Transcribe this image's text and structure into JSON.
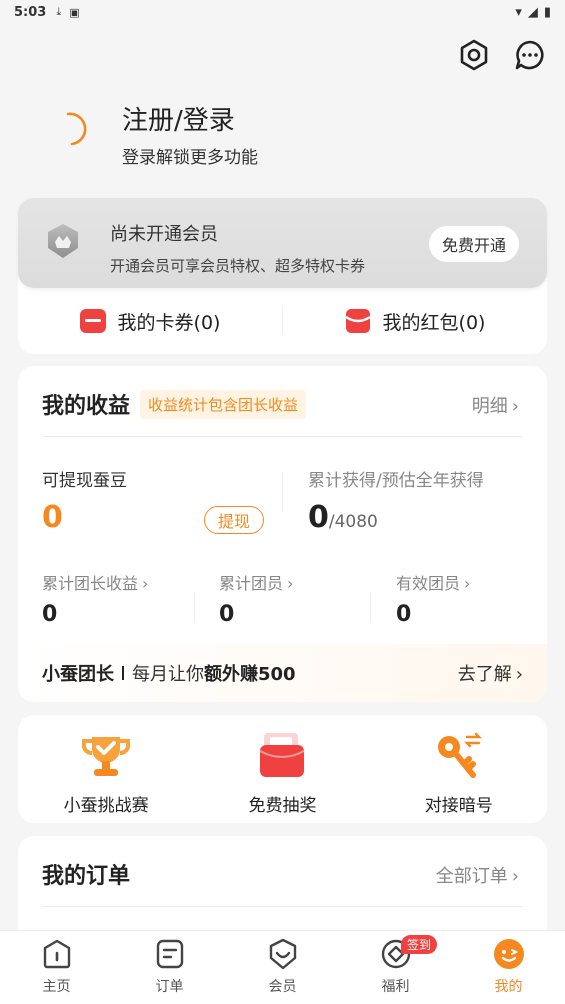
{
  "status_bar": {
    "time": "5:03"
  },
  "header": {
    "settings_icon": "settings-hex-icon",
    "message_icon": "chat-bubble-icon"
  },
  "profile": {
    "title": "注册/登录",
    "subtitle": "登录解锁更多功能"
  },
  "member": {
    "title": "尚未开通会员",
    "subtitle": "开通会员可享会员特权、超多特权卡券",
    "open_button": "免费开通"
  },
  "coupons": [
    {
      "label": "我的卡券(0)",
      "icon": "ticket-icon"
    },
    {
      "label": "我的红包(0)",
      "icon": "red-envelope-icon"
    }
  ],
  "earnings": {
    "title": "我的收益",
    "tag": "收益统计包含团长收益",
    "detail": "明细",
    "withdraw_label": "可提现蚕豆",
    "withdraw_value": "0",
    "withdraw_button": "提现",
    "total_label": "累计获得/预估全年获得",
    "total_value": "0",
    "total_estimate": "/4080",
    "stats": [
      {
        "label": "累计团长收益",
        "value": "0"
      },
      {
        "label": "累计团员",
        "value": "0"
      },
      {
        "label": "有效团员",
        "value": "0"
      }
    ],
    "leader": {
      "title": "小蚕团长",
      "desc_prefix": "每月让你",
      "desc_bold": "额外赚500",
      "more": "去了解"
    }
  },
  "tools": [
    {
      "label": "小蚕挑战赛",
      "icon": "trophy-icon"
    },
    {
      "label": "免费抽奖",
      "icon": "lottery-box-icon"
    },
    {
      "label": "对接暗号",
      "icon": "key-icon"
    }
  ],
  "orders": {
    "title": "我的订单",
    "all": "全部订单"
  },
  "tabbar": {
    "items": [
      {
        "label": "主页",
        "icon": "home-icon"
      },
      {
        "label": "订单",
        "icon": "order-icon"
      },
      {
        "label": "会员",
        "icon": "member-icon"
      },
      {
        "label": "福利",
        "icon": "welfare-icon",
        "badge": "签到"
      },
      {
        "label": "我的",
        "icon": "profile-face-icon"
      }
    ]
  },
  "colors": {
    "accent": "#f5891f",
    "red": "#f04141"
  }
}
